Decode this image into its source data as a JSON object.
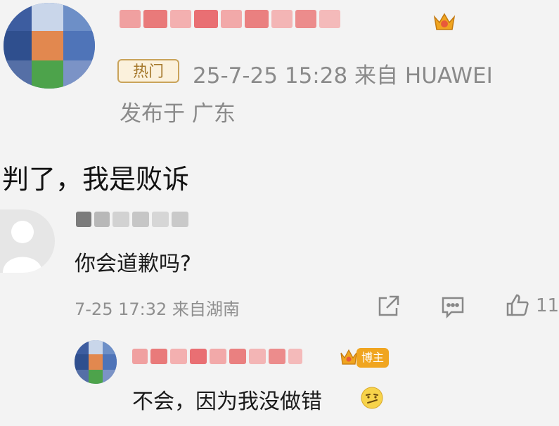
{
  "post": {
    "tag": "热门",
    "meta": "25-7-25 15:28  来自 HUAWEI",
    "location": "发布于 广东",
    "body": "判了，我是败诉"
  },
  "comment": {
    "text": "你会道歉吗?",
    "meta": "7-25 17:32 来自湖南",
    "like_count": "11"
  },
  "reply": {
    "badge": "博主",
    "text": "不会，因为我没做错"
  },
  "icons": {
    "share": "share-icon",
    "comment": "comment-icon",
    "like": "like-icon",
    "vip_crown": "crown-icon",
    "emoji": "smirk-emoji-icon"
  },
  "colors": {
    "background": "#f3f3f3",
    "blurred_name": "#e96f73",
    "badge_gold": "#f0a520",
    "meta_gray": "#8a8a8a"
  }
}
